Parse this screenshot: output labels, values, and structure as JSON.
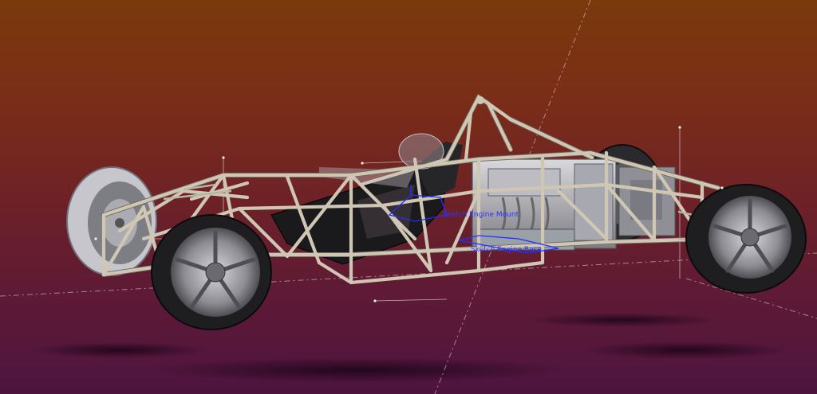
{
  "viewport": {
    "background_top": "#7a3a0c",
    "background_bottom": "#4e1440"
  },
  "scene": {
    "frame_tube_color": "#cfc6b4",
    "tire_color": "#2b2b2b",
    "rim_color": "#9a9aa0",
    "sketch_color": "#2030ff",
    "reference_line_color": "#e6d8e0"
  },
  "annotations": {
    "sketch_label_1": "Sketch Engine Mount",
    "sketch_label_2": "Sketch Engine Base"
  },
  "icons": [
    "rear-wheel-icon",
    "front-wheel-icon",
    "engine-icon",
    "seat-icon",
    "roll-hoop-icon"
  ]
}
